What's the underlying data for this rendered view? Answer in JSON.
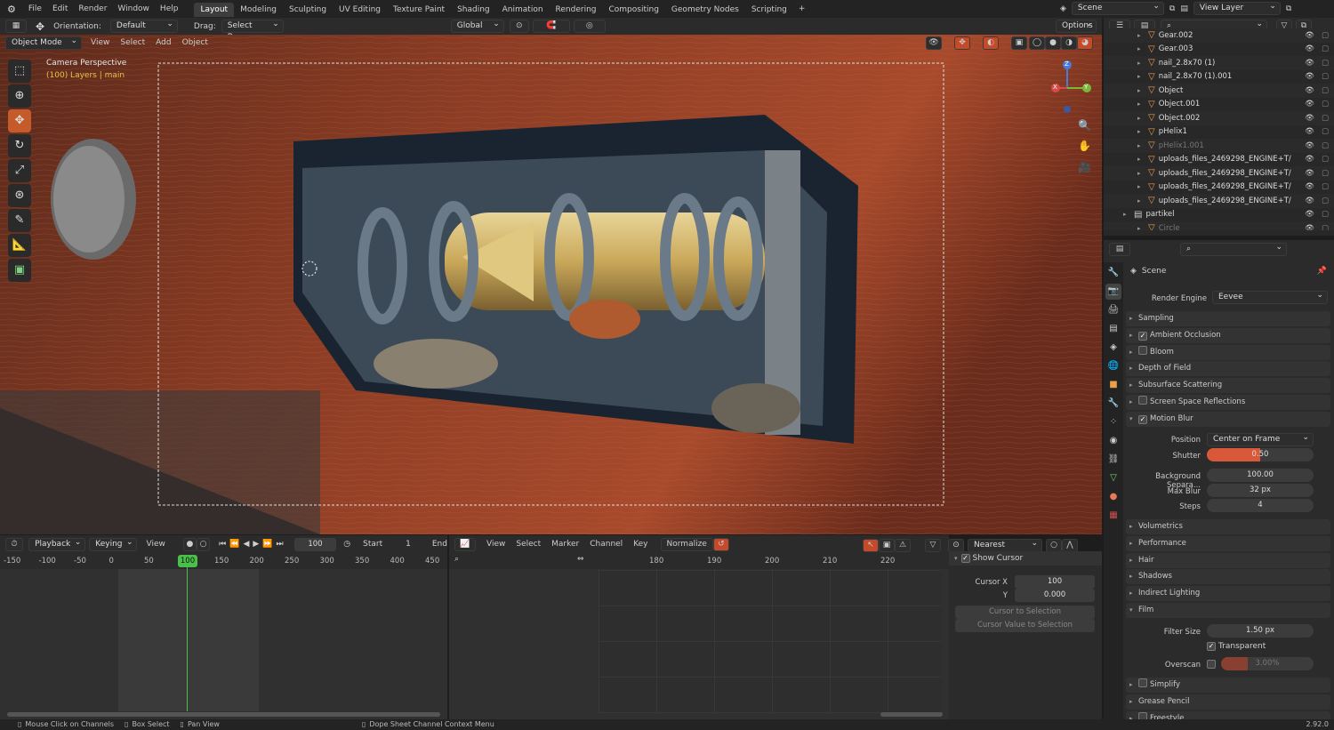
{
  "menubar": {
    "items": [
      "File",
      "Edit",
      "Render",
      "Window",
      "Help"
    ]
  },
  "workspaces": [
    "Layout",
    "Modeling",
    "Sculpting",
    "UV Editing",
    "Texture Paint",
    "Shading",
    "Animation",
    "Rendering",
    "Compositing",
    "Geometry Nodes",
    "Scripting"
  ],
  "active_workspace": "Layout",
  "scene_name": "Scene",
  "view_layer": "View Layer",
  "toolheader": {
    "orientation_label": "Orientation:",
    "orientation_value": "Default",
    "drag_label": "Drag:",
    "drag_value": "Select Box",
    "transform_value": "Global",
    "options": "Options"
  },
  "viewport_header": {
    "mode": "Object Mode",
    "menus": [
      "View",
      "Select",
      "Add",
      "Object"
    ]
  },
  "viewport": {
    "camera_label": "Camera Perspective",
    "layer_label": "(100) Layers | main",
    "axis_labels": {
      "z": "Z",
      "x": "X",
      "y": "Y"
    }
  },
  "timeline": {
    "menus": [
      "Playback",
      "Keying",
      "View"
    ],
    "current_frame": "100",
    "start_label": "Start",
    "start_value": "1",
    "end_label": "End",
    "ticks": [
      "-150",
      "-100",
      "-50",
      "0",
      "50",
      "100",
      "150",
      "200",
      "250",
      "300",
      "350",
      "400",
      "450"
    ]
  },
  "graph": {
    "menus": [
      "View",
      "Select",
      "Marker",
      "Channel",
      "Key"
    ],
    "normalize": "Normalize",
    "snap": "Nearest Frame",
    "ticks": [
      "180",
      "190",
      "200",
      "210",
      "220"
    ],
    "show_cursor": "Show Cursor",
    "cursor_x_label": "Cursor X",
    "cursor_x": "100",
    "cursor_y_label": "Y",
    "cursor_y": "0.000",
    "cursor_to_selection": "Cursor to Selection",
    "cursor_value_to_selection": "Cursor Value to Selection"
  },
  "outliner": {
    "rows": [
      {
        "name": "Gear.002",
        "dim": false
      },
      {
        "name": "Gear.003",
        "dim": false
      },
      {
        "name": "nail_2.8x70 (1)",
        "dim": false
      },
      {
        "name": "nail_2.8x70 (1).001",
        "dim": false
      },
      {
        "name": "Object",
        "dim": false
      },
      {
        "name": "Object.001",
        "dim": false
      },
      {
        "name": "Object.002",
        "dim": false
      },
      {
        "name": "pHelix1",
        "dim": false
      },
      {
        "name": "pHelix1.001",
        "dim": true
      },
      {
        "name": "uploads_files_2469298_ENGINE+T/",
        "dim": false
      },
      {
        "name": "uploads_files_2469298_ENGINE+T/",
        "dim": false
      },
      {
        "name": "uploads_files_2469298_ENGINE+T/",
        "dim": false
      },
      {
        "name": "uploads_files_2469298_ENGINE+T/",
        "dim": false
      },
      {
        "name": "partikel",
        "dim": false
      },
      {
        "name": "Circle",
        "dim": true
      }
    ]
  },
  "properties": {
    "scene": "Scene",
    "render_engine_label": "Render Engine",
    "render_engine": "Eevee",
    "sections": [
      {
        "label": "Sampling",
        "checkbox": null,
        "checked": false,
        "open": false
      },
      {
        "label": "Ambient Occlusion",
        "checkbox": true,
        "checked": true,
        "open": false
      },
      {
        "label": "Bloom",
        "checkbox": true,
        "checked": false,
        "open": false
      },
      {
        "label": "Depth of Field",
        "checkbox": null,
        "checked": false,
        "open": false
      },
      {
        "label": "Subsurface Scattering",
        "checkbox": null,
        "checked": false,
        "open": false
      },
      {
        "label": "Screen Space Reflections",
        "checkbox": true,
        "checked": false,
        "open": false
      },
      {
        "label": "Motion Blur",
        "checkbox": true,
        "checked": true,
        "open": true
      }
    ],
    "motion_blur": {
      "position_label": "Position",
      "position": "Center on Frame",
      "shutter_label": "Shutter",
      "shutter": "0.50",
      "shutter_fraction": 0.5,
      "bg_sep_label": "Background Separa...",
      "bg_sep": "100.00",
      "max_blur_label": "Max Blur",
      "max_blur": "32 px",
      "steps_label": "Steps",
      "steps": "4"
    },
    "sections2": [
      "Volumetrics",
      "Performance",
      "Hair",
      "Shadows",
      "Indirect Lighting",
      "Film"
    ],
    "film": {
      "filter_size_label": "Filter Size",
      "filter_size": "1.50 px",
      "transparent": "Transparent",
      "overscan_label": "Overscan",
      "overscan": "3.00%"
    },
    "sections3": [
      {
        "label": "Simplify",
        "checkbox": true
      },
      {
        "label": "Grease Pencil",
        "checkbox": false
      },
      {
        "label": "Freestyle",
        "checkbox": true
      }
    ]
  },
  "status": {
    "items": [
      "Mouse Click on Channels",
      "Box Select",
      "Pan View",
      "Dope Sheet Channel Context Menu"
    ],
    "version": "2.92.0"
  }
}
